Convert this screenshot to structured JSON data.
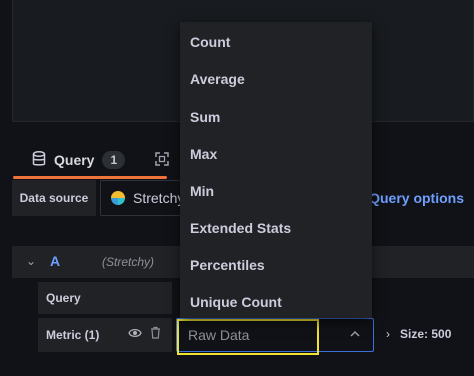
{
  "tabs": {
    "query_label": "Query",
    "query_count": "1"
  },
  "datasource": {
    "label": "Data source",
    "selected": "Stretchy",
    "query_options_label": "Query options"
  },
  "query_row": {
    "ref_id": "A",
    "datasource_hint": "(Stretchy)",
    "query_label": "Query",
    "metric_label": "Metric (1)",
    "metric_value": "Raw Data",
    "size_label": "Size: 500"
  },
  "dropdown": {
    "options": [
      "Count",
      "Average",
      "Sum",
      "Max",
      "Min",
      "Extended Stats",
      "Percentiles",
      "Unique Count"
    ]
  },
  "colors": {
    "accent_tab": "#f0733a",
    "link_blue": "#6e9fff",
    "highlight": "#f1e332"
  },
  "icons": {
    "query_tab": "database-icon",
    "transform_tab": "transform-icon",
    "row_toggle": "chevron-down-icon",
    "visibility": "eye-icon",
    "delete": "trash-icon",
    "select_caret": "chevron-up-icon",
    "size_toggle": "chevron-right-icon"
  }
}
